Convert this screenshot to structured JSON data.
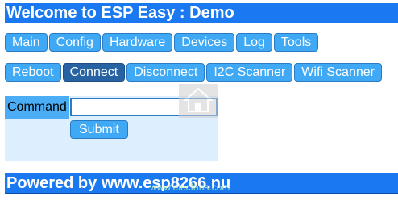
{
  "header": {
    "title": "Welcome to ESP Easy : Demo"
  },
  "nav": {
    "items": [
      {
        "label": "Main"
      },
      {
        "label": "Config"
      },
      {
        "label": "Hardware"
      },
      {
        "label": "Devices"
      },
      {
        "label": "Log"
      },
      {
        "label": "Tools"
      }
    ]
  },
  "tools": {
    "items": [
      {
        "label": "Reboot",
        "active": false
      },
      {
        "label": "Connect",
        "active": true
      },
      {
        "label": "Disconnect",
        "active": false
      },
      {
        "label": "I2C Scanner",
        "active": false
      },
      {
        "label": "Wifi Scanner",
        "active": false
      }
    ]
  },
  "form": {
    "command_label": "Command",
    "command_value": "",
    "submit_label": "Submit"
  },
  "footer": {
    "text": "Powered by www.esp8266.nu"
  },
  "watermark": {
    "text": "www.elecfans.com",
    "icon": "house-logo-icon"
  },
  "colors": {
    "bar": "#1a78f0",
    "button": "#3fa9f5",
    "button_active": "#2763a3",
    "panel": "#ddeeff",
    "label_bg": "#4aadf5"
  }
}
